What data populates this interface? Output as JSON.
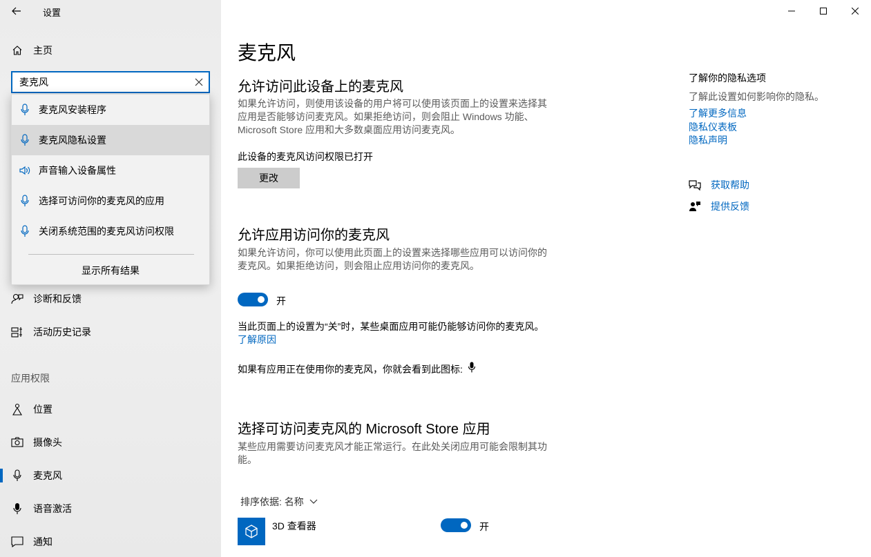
{
  "window": {
    "title": "设置",
    "minimize_icon": "minimize-icon",
    "maximize_icon": "maximize-icon",
    "close_icon": "close-icon"
  },
  "sidebar": {
    "home_label": "主页",
    "search": {
      "value": "麦克风",
      "placeholder": ""
    },
    "suggestions": [
      {
        "label": "麦克风安装程序",
        "icon": "microphone-icon"
      },
      {
        "label": "麦克风隐私设置",
        "icon": "microphone-icon"
      },
      {
        "label": "声音输入设备属性",
        "icon": "speaker-icon"
      },
      {
        "label": "选择可访问你的麦克风的应用",
        "icon": "microphone-icon"
      },
      {
        "label": "关闭系统范围的麦克风访问权限",
        "icon": "microphone-icon"
      }
    ],
    "show_all_label": "显示所有结果",
    "items_upper": [
      {
        "label": "诊断和反馈",
        "icon": "feedback-person-icon"
      },
      {
        "label": "活动历史记录",
        "icon": "timeline-icon"
      }
    ],
    "section_header": "应用权限",
    "items_lower": [
      {
        "label": "位置",
        "icon": "location-icon"
      },
      {
        "label": "摄像头",
        "icon": "camera-icon"
      },
      {
        "label": "麦克风",
        "icon": "microphone-icon"
      },
      {
        "label": "语音激活",
        "icon": "voice-activation-icon"
      },
      {
        "label": "通知",
        "icon": "notification-icon"
      }
    ]
  },
  "main": {
    "title": "麦克风",
    "device_section": {
      "heading": "允许访问此设备上的麦克风",
      "description": "如果允许访问，则使用该设备的用户将可以使用该页面上的设置来选择其应用是否能够访问麦克风。如果拒绝访问，则会阻止 Windows 功能、Microsoft Store 应用和大多数桌面应用访问麦克风。",
      "status": "此设备的麦克风访问权限已打开",
      "change_label": "更改"
    },
    "apps_section": {
      "heading": "允许应用访问你的麦克风",
      "description": "如果允许访问，你可以使用此页面上的设置来选择哪些应用可以访问你的麦克风。如果拒绝访问，则会阻止应用访问你的麦克风。",
      "toggle_label": "开",
      "note": "当此页面上的设置为“关”时，某些桌面应用可能仍能够访问你的麦克风。",
      "learn_why": "了解原因",
      "icon_note": "如果有应用正在使用你的麦克风，你就会看到此图标:"
    },
    "store_section": {
      "heading": "选择可访问麦克风的 Microsoft Store 应用",
      "description": "某些应用需要访问麦克风才能正常运行。在此处关闭应用可能会限制其功能。",
      "sort_label": "排序依据: 名称",
      "apps": [
        {
          "name": "3D 查看器",
          "toggle_label": "开",
          "icon": "3d-cube-icon"
        }
      ]
    }
  },
  "right": {
    "heading": "了解你的隐私选项",
    "text": "了解此设置如何影响你的隐私。",
    "links": [
      "了解更多信息",
      "隐私仪表板",
      "隐私声明"
    ],
    "help_label": "获取帮助",
    "feedback_label": "提供反馈"
  },
  "colors": {
    "accent": "#0067c0",
    "sidebar_bg": "#eeeeee",
    "button_bg": "#cccccc"
  }
}
